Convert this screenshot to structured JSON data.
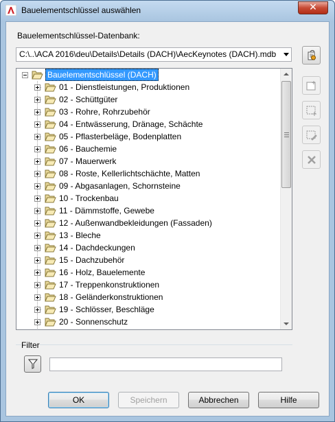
{
  "window": {
    "title": "Bauelementschlüssel auswählen",
    "close_label": "✕"
  },
  "database": {
    "label": "Bauelementschlüssel-Datenbank:",
    "selected": "C:\\..\\ACA 2016\\deu\\Details\\Details (DACH)\\AecKeynotes (DACH).mdb"
  },
  "tree": {
    "root": "Bauelementschlüssel (DACH)",
    "items": [
      "01 - Dienstleistungen, Produktionen",
      "02 - Schüttgüter",
      "03 - Rohre, Rohrzubehör",
      "04 - Entwässerung, Dränage, Schächte",
      "05 - Pflasterbeläge, Bodenplatten",
      "06 - Bauchemie",
      "07 - Mauerwerk",
      "08 - Roste, Kellerlichtschächte, Matten",
      "09 - Abgasanlagen, Schornsteine",
      "10 - Trockenbau",
      "11 - Dämmstoffe, Gewebe",
      "12 - Außenwandbekleidungen (Fassaden)",
      "13 - Bleche",
      "14 - Dachdeckungen",
      "15 - Dachzubehör",
      "16 - Holz, Bauelemente",
      "17 - Treppenkonstruktionen",
      "18 - Geländerkonstruktionen",
      "19 - Schlösser, Beschläge",
      "20 - Sonnenschutz"
    ]
  },
  "filter": {
    "title": "Filter",
    "value": ""
  },
  "buttons": {
    "ok": "OK",
    "save": "Speichern",
    "cancel": "Abbrechen",
    "help": "Hilfe"
  }
}
